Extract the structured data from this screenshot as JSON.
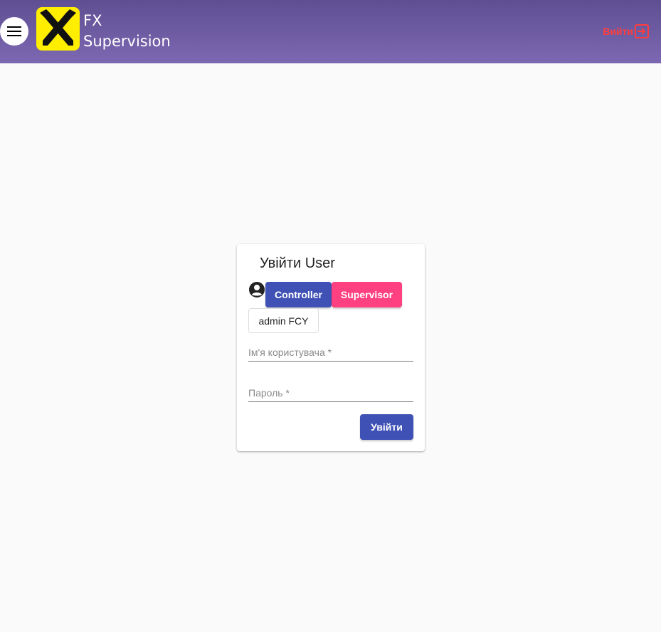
{
  "app": {
    "title_line1": "FX",
    "title_line2": "Supervision",
    "logout_label": "Вийти"
  },
  "login": {
    "title": "Увійти User",
    "role_controller": "Controller",
    "role_supervisor": "Supervisor",
    "admin_label": "admin FCY",
    "username_placeholder": "Ім'я користувача *",
    "password_placeholder": "Пароль *",
    "submit_label": "Увійти"
  },
  "colors": {
    "header": "#6f5ea4",
    "primary": "#3f51b5",
    "accent": "#ff4081",
    "logout": "#ff3d3d",
    "logo_bg": "#ffee00"
  },
  "icons": {
    "menu": "menu-icon",
    "logo": "raiffeisen-logo",
    "logout": "logout-icon",
    "account": "account-circle-icon"
  }
}
